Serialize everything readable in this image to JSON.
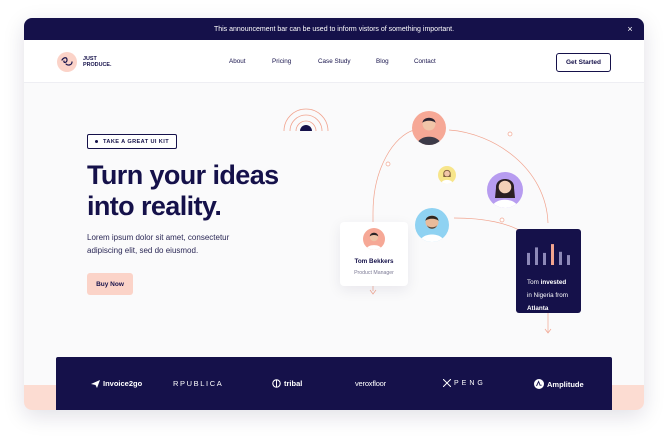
{
  "announcement": {
    "text": "This announcement bar can be used to inform vistors of something important.",
    "close_glyph": "×"
  },
  "brand": {
    "name": "JUST\nPRODUCE.",
    "mark_icon": "squiggle-icon",
    "mark_color": "#fbd3c8"
  },
  "nav": {
    "items": [
      "About",
      "Pricing",
      "Case Study",
      "Blog",
      "Contact"
    ],
    "cta_label": "Get Started"
  },
  "hero": {
    "badge": "TAKE A GREAT UI KIT",
    "title_line1": "Turn your ideas",
    "title_line2": "into reality.",
    "subtitle_line1": "Lorem ipsum dolor sit amet, consectetur",
    "subtitle_line2": "adipiscing elit, sed do eiusmod.",
    "button_label": "Buy Now"
  },
  "illustration": {
    "profile_card": {
      "name": "Tom Bekkers",
      "role": "Product Manager"
    },
    "stat_card": {
      "line1_name": "Tom",
      "line1_verb": "invested",
      "line2": "in Nigeria from",
      "line3": "Atlanta",
      "bar_levels": [
        0.55,
        0.8,
        0.55,
        0.95,
        0.6,
        0.45
      ],
      "highlight_bar_index": 3
    },
    "avatars": [
      {
        "role": "top",
        "bg": "#f6a896"
      },
      {
        "role": "small",
        "bg": "#f7e58b"
      },
      {
        "role": "right",
        "bg": "#b79cf0"
      },
      {
        "role": "center",
        "bg": "#8fd2f2"
      },
      {
        "role": "card",
        "bg": "#f6a896"
      }
    ]
  },
  "logos": [
    "Invoice2go",
    "RPUBLICA",
    "tribal",
    "veroxfloor",
    "PENG",
    "Amplitude"
  ],
  "colors": {
    "navy": "#15114a",
    "peach": "#fbd3c8",
    "accent_line": "#f1a48f",
    "page_bg": "#fafafb"
  }
}
